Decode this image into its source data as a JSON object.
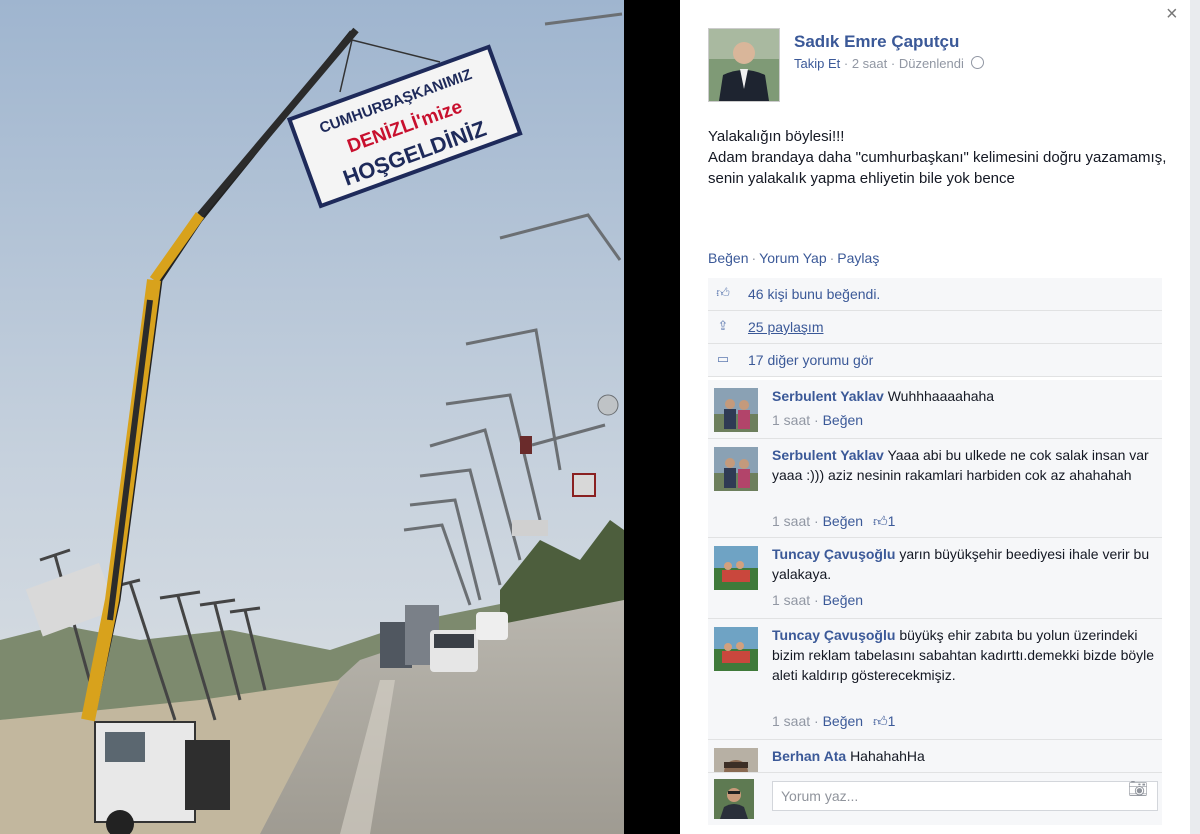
{
  "photo": {
    "banner_line1": "CUMHURBAŞKANIMIZ",
    "banner_line2": "DENİZLİ'mize",
    "banner_line3": "HOŞGELDİNİZ"
  },
  "post": {
    "close_label": "×",
    "author": "Sadık Emre Çaputçu",
    "follow_label": "Takip Et",
    "time": "2 saat",
    "edited": "Düzenlendi",
    "text": "Yalakalığın böylesi!!!\nAdam brandaya daha \"cumhurbaşkanı\" kelimesini doğru yazamamış, senin yalakalık yapma ehliyetin bile yok bence",
    "actions": {
      "like": "Beğen",
      "comment": "Yorum Yap",
      "share": "Paylaş"
    },
    "likes_text": "46 kişi bunu beğendi.",
    "shares_text": "25 paylaşım",
    "more_comments_text": "17 diğer yorumu gör"
  },
  "comments": [
    {
      "name": "Serbulent Yaklav",
      "text": "Wuhhhaaaahaha",
      "time": "1 saat",
      "like_label": "Beğen",
      "likes": ""
    },
    {
      "name": "Serbulent Yaklav",
      "text": "Yaaa abi bu ulkede ne cok salak insan var yaaa :))) aziz nesinin rakamlari harbiden cok az ahahahah",
      "time": "1 saat",
      "like_label": "Beğen",
      "likes": "1"
    },
    {
      "name": "Tuncay Çavuşoğlu",
      "text": "yarın büyükşehir beediyesi ihale verir bu yalakaya.",
      "time": "1 saat",
      "like_label": "Beğen",
      "likes": ""
    },
    {
      "name": "Tuncay Çavuşoğlu",
      "text": "büyükş ehir zabıta bu yolun üzerindeki bizim reklam tabelasını sabahtan kadırttı.demekki bizde böyle aleti kaldırıp gösterecekmişiz.",
      "time": "1 saat",
      "like_label": "Beğen",
      "likes": "1"
    },
    {
      "name": "Berhan Ata",
      "text": "HahahahHa",
      "time": "",
      "like_label": "",
      "likes": ""
    }
  ],
  "composer": {
    "placeholder": "Yorum yaz..."
  },
  "colors": {
    "link": "#3b5998",
    "meta": "#9197a3",
    "row_bg": "#f6f7f9",
    "banner_red": "#c8102e",
    "crane_yellow": "#d8a21c"
  },
  "icons": [
    "close-icon",
    "globe-icon",
    "thumbs-up-icon",
    "share-icon",
    "comment-icon",
    "camera-icon"
  ]
}
